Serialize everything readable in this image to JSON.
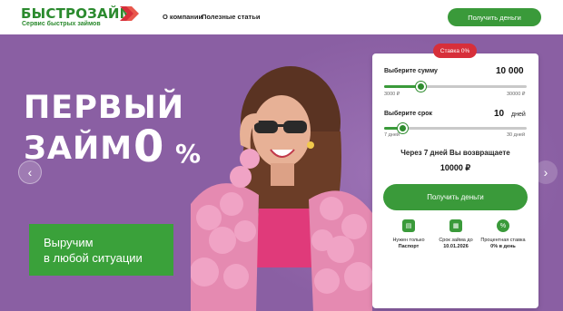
{
  "header": {
    "logo": "БЫСТРОЗАЙМ",
    "logo_sub": "Сервис быстрых займов",
    "nav": [
      "О компании",
      "Полезные статьи"
    ],
    "cta": "Получить деньги"
  },
  "hero": {
    "promo_line1": "ПЕРВЫЙ",
    "promo_line2": "ЗАЙМ",
    "promo_zero": "0",
    "promo_pct": "%",
    "tagline_line1": "Выручим",
    "tagline_line2": "в любой ситуации",
    "arrow_left": "‹",
    "arrow_right": "›"
  },
  "calculator": {
    "rate_badge": "Ставка 0%",
    "amount_label": "Выберите сумму",
    "amount_value": "10 000",
    "amount_min": "3000 ₽",
    "amount_max": "30000 ₽",
    "amount_fraction": 0.26,
    "term_label": "Выберите срок",
    "term_value": "10",
    "term_unit": "дней",
    "term_min": "7 дней",
    "term_max": "30 дней",
    "term_fraction": 0.13,
    "return_text": "Через 7 дней Вы возвращаете",
    "return_sum": "10000 ₽",
    "cta": "Получить деньги",
    "features": [
      {
        "icon": "passport-icon",
        "line1": "Нужен только",
        "line2": "Паспорт"
      },
      {
        "icon": "calendar-icon",
        "line1": "Срок займа до",
        "line2": "10.01.2026"
      },
      {
        "icon": "percent-icon",
        "line1": "Процентная ставка",
        "line2": "0% в день"
      }
    ]
  },
  "colors": {
    "brand_green": "#3a9a3a",
    "hero_purple": "#8a5fa3",
    "badge_red": "#d72f3a"
  }
}
